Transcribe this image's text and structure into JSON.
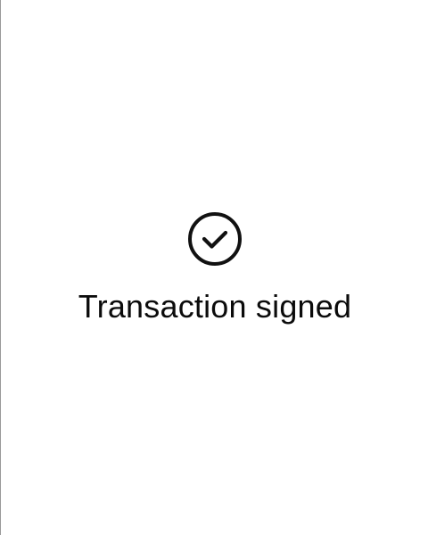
{
  "status": {
    "icon": "check-circle-icon",
    "title": "Transaction signed"
  },
  "colors": {
    "background": "#ffffff",
    "text": "#0b0b0b",
    "icon": "#111111",
    "window_edge": "#9a9a9a"
  }
}
